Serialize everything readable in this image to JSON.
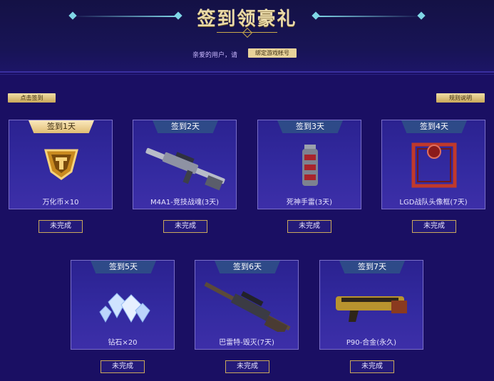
{
  "header": {
    "title": "签到领豪礼",
    "greeting": "亲爱的用户，请",
    "bind_button": "绑定游戏帐号"
  },
  "toolbar": {
    "checkin_button": "点击签到",
    "rules_button": "规则说明"
  },
  "cards": [
    {
      "day": "签到1天",
      "name": "万化币×10",
      "status": "未完成",
      "icon": "gold-coin-icon"
    },
    {
      "day": "签到2天",
      "name": "M4A1-竞技战魂(3天)",
      "status": "未完成",
      "icon": "rifle-icon"
    },
    {
      "day": "签到3天",
      "name": "死神手雷(3天)",
      "status": "未完成",
      "icon": "grenade-icon"
    },
    {
      "day": "签到4天",
      "name": "LGD战队头像框(7天)",
      "status": "未完成",
      "icon": "avatar-frame-icon"
    },
    {
      "day": "签到5天",
      "name": "钻石×20",
      "status": "未完成",
      "icon": "diamond-icon"
    },
    {
      "day": "签到6天",
      "name": "巴雷特-毁灭(7天)",
      "status": "未完成",
      "icon": "sniper-rifle-icon"
    },
    {
      "day": "签到7天",
      "name": "P90-合金(永久)",
      "status": "未完成",
      "icon": "smg-icon"
    }
  ],
  "colors": {
    "background": "#1a0f63",
    "gold_accent": "#e0bd74",
    "tag_blue": "#2e4a88"
  }
}
